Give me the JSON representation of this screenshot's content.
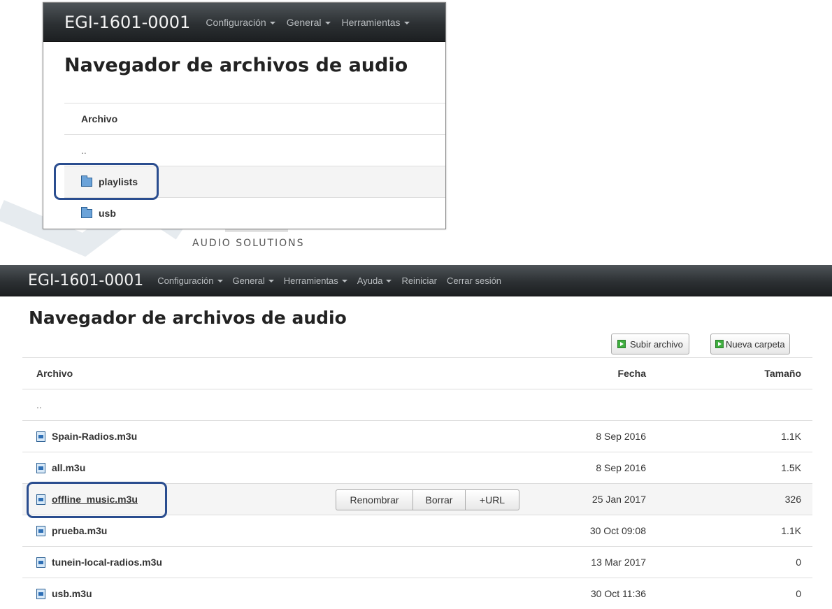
{
  "inset": {
    "brand": "EGI-1601-0001",
    "nav": [
      "Configuración",
      "General",
      "Herramientas"
    ],
    "title": "Navegador de archivos de audio",
    "column": "Archivo",
    "up": "..",
    "folders": [
      "playlists",
      "usb"
    ]
  },
  "logo_caption": "AUDIO SOLUTIONS",
  "navbar": {
    "brand": "EGI-1601-0001",
    "menus": [
      "Configuración",
      "General",
      "Herramientas",
      "Ayuda"
    ],
    "links": [
      "Reiniciar",
      "Cerrar sesión"
    ]
  },
  "page": {
    "title": "Navegador de archivos de audio",
    "upload_label": "Subir archivo",
    "new_folder_label": "Nueva carpeta"
  },
  "table": {
    "headers": {
      "name": "Archivo",
      "date": "Fecha",
      "size": "Tamaño"
    },
    "up": "..",
    "rows": [
      {
        "name": "Spain-Radios.m3u",
        "date": "8 Sep 2016",
        "size": "1.1K"
      },
      {
        "name": "all.m3u",
        "date": "8 Sep 2016",
        "size": "1.5K"
      },
      {
        "name": "offline_music.m3u",
        "date": "25 Jan 2017",
        "size": "326"
      },
      {
        "name": "prueba.m3u",
        "date": "30 Oct 09:08",
        "size": "1.1K"
      },
      {
        "name": "tunein-local-radios.m3u",
        "date": "13 Mar 2017",
        "size": "0"
      },
      {
        "name": "usb.m3u",
        "date": "30 Oct 11:36",
        "size": "0"
      }
    ],
    "row_actions": [
      "Renombrar",
      "Borrar",
      "+URL"
    ]
  },
  "colors": {
    "navbar": "#2c3033",
    "callout": "#2a4d8f",
    "button_icon": "#3fae3f",
    "file_icon": "#2e6fb5"
  }
}
